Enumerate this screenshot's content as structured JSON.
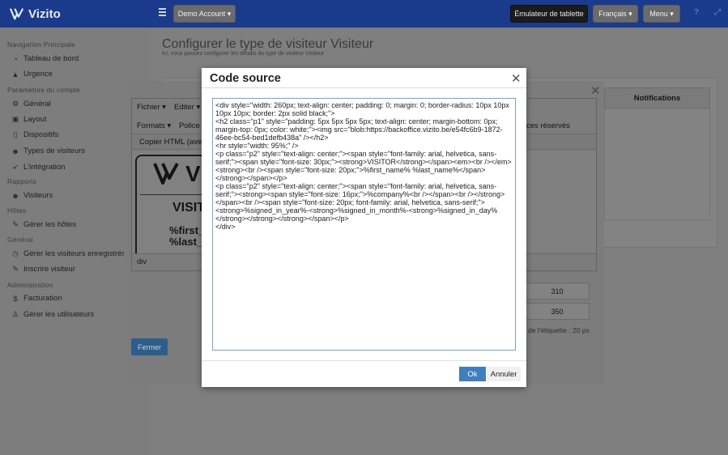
{
  "app": {
    "name": "Vizito"
  },
  "topbar": {
    "account_label": "Demo Account ▾",
    "emulator_label": "Émulateur de tablette",
    "language_label": "Français ▾",
    "menu_label": "Menu ▾"
  },
  "sidebar": {
    "sections": [
      {
        "heading": "Navigation Principale",
        "items": [
          {
            "label": "Tableau de bord",
            "icon": "dashboard-icon"
          },
          {
            "label": "Urgence",
            "icon": "warning-icon"
          }
        ]
      },
      {
        "heading": "Paramètres du compte",
        "items": [
          {
            "label": "Général",
            "icon": "gear-icon"
          },
          {
            "label": "Layout",
            "icon": "layout-icon"
          },
          {
            "label": "Dispositifs",
            "icon": "tablet-icon"
          },
          {
            "label": "Types de visiteurs",
            "icon": "users-icon"
          },
          {
            "label": "L'intégration",
            "icon": "rocket-icon"
          }
        ]
      },
      {
        "heading": "Rapports",
        "items": [
          {
            "label": "Visiteurs",
            "icon": "users-icon"
          }
        ]
      },
      {
        "heading": "Hôtes",
        "items": [
          {
            "label": "Gérer les hôtes",
            "icon": "pen-icon"
          }
        ]
      },
      {
        "heading": "Général",
        "items": [
          {
            "label": "Gérer les visiteurs enregistrés",
            "icon": "clock-icon"
          },
          {
            "label": "Inscrire visiteur",
            "icon": "pen-icon"
          }
        ]
      },
      {
        "heading": "Administration",
        "items": [
          {
            "label": "Facturation",
            "icon": "dollar-icon"
          },
          {
            "label": "Gérer les utilisateurs",
            "icon": "user-plus-icon"
          }
        ]
      }
    ]
  },
  "page": {
    "title": "Configurer le type de visiteur Visiteur",
    "subtitle": "Ici, vous pouvez configurer les détails du type de visiteur Visiteur"
  },
  "background_modal": {
    "menu_file": "Fichier ▾",
    "menu_edit": "Editer ▾",
    "menu_formats": "Formats ▾",
    "menu_font": "Police",
    "tab_html": "Copier HTML (avec",
    "right_text": "ces réservés",
    "preview_logo": "V",
    "preview_visitor": "VISIT",
    "preview_first": "%first_",
    "preview_last": "%last_",
    "status_path": "div",
    "close_button": "Fermer",
    "notifications_header": "Notifications",
    "width_value": "310",
    "height_value": "350",
    "label_note": "de l'étiquette : 20 px"
  },
  "dialog": {
    "title": "Code source",
    "source": "<div style=\"width: 260px; text-align: center; padding: 0; margin: 0; border-radius: 10px 10px 10px 10px; border: 2px solid black;\">\n<h2 class=\"p1\" style=\"padding: 5px 5px 5px 5px; text-align: center; margin-bottom: 0px; margin-top: 0px; color: white;\"><img src=\"blob:https://backoffice.vizito.be/e54fc6b9-1872-46ee-bc54-bed1defb438a\" /></h2>\n<hr style=\"width: 95%;\" />\n<p class=\"p2\" style=\"text-align: center;\"><span style=\"font-family: arial, helvetica, sans-serif;\"><span style=\"font-size: 30px;\"><strong>VISITOR</strong></span><em><br /></em><strong><br /><span style=\"font-size: 20px;\">%first_name% %last_name%</span></strong></span></p>\n<p class=\"p2\" style=\"text-align: center;\"><span style=\"font-family: arial, helvetica, sans-serif;\"><strong><span style=\"font-size: 16px;\">%company%<br /></span><br /></strong></span><br /><span style=\"font-size: 20px; font-family: arial, helvetica, sans-serif;\"><strong>%signed_in_year%-<strong>%signed_in_month%-<strong>%signed_in_day%</strong></strong></strong></span></p>\n</div>",
    "ok_label": "Ok",
    "cancel_label": "Annuler"
  }
}
